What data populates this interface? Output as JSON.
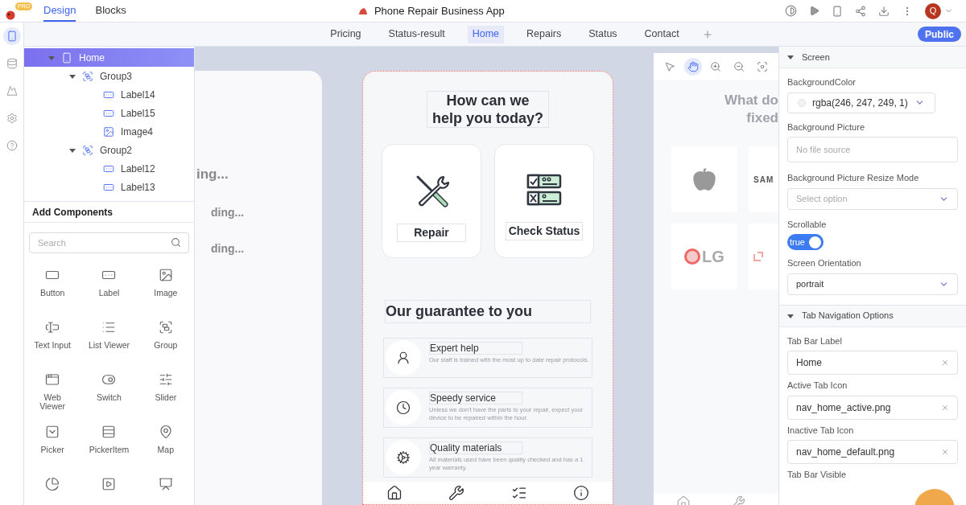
{
  "app": {
    "badge": "PRO",
    "modes": [
      {
        "label": "Design",
        "selected": true
      },
      {
        "label": "Blocks",
        "selected": false
      }
    ],
    "title": "Phone Repair Business App",
    "avatar": "Q"
  },
  "screens": {
    "tabs": [
      {
        "label": "Pricing",
        "selected": false
      },
      {
        "label": "Status-result",
        "selected": false
      },
      {
        "label": "Home",
        "selected": true
      },
      {
        "label": "Repairs",
        "selected": false
      },
      {
        "label": "Status",
        "selected": false
      },
      {
        "label": "Contact",
        "selected": false
      }
    ],
    "publish_button": "Public"
  },
  "rail": [
    {
      "kind": "screens",
      "selected": true
    },
    {
      "kind": "data",
      "selected": false
    },
    {
      "kind": "media",
      "selected": false
    },
    {
      "kind": "settings",
      "selected": false
    },
    {
      "kind": "help",
      "selected": false
    }
  ],
  "tree": [
    {
      "label": "Home",
      "kind": "screen",
      "expanded": true,
      "selected": true,
      "children": [
        {
          "label": "Group3",
          "kind": "group",
          "expanded": true,
          "selected": false,
          "children": [
            {
              "label": "Label14",
              "kind": "label",
              "selected": false
            },
            {
              "label": "Label15",
              "kind": "label",
              "selected": false
            },
            {
              "label": "Image4",
              "kind": "image",
              "selected": false
            }
          ]
        },
        {
          "label": "Group2",
          "kind": "group",
          "expanded": true,
          "selected": false,
          "children": [
            {
              "label": "Label12",
              "kind": "label",
              "selected": false
            },
            {
              "label": "Label13",
              "kind": "label",
              "selected": false
            }
          ]
        }
      ]
    }
  ],
  "components": {
    "title": "Add Components",
    "search": {
      "placeholder": "Search"
    },
    "items": [
      {
        "kind": "button",
        "label": "Button"
      },
      {
        "kind": "label",
        "label": "Label"
      },
      {
        "kind": "image",
        "label": "Image"
      },
      {
        "kind": "textinput",
        "label": "Text Input"
      },
      {
        "kind": "list",
        "label": "List Viewer"
      },
      {
        "kind": "group",
        "label": "Group"
      },
      {
        "kind": "web",
        "label": "Web Viewer"
      },
      {
        "kind": "switch",
        "label": "Switch"
      },
      {
        "kind": "slider",
        "label": "Slider"
      },
      {
        "kind": "picker",
        "label": "Picker"
      },
      {
        "kind": "pickeritem",
        "label": "PickerItem"
      },
      {
        "kind": "map",
        "label": "Map"
      },
      {
        "kind": "chart"
      },
      {
        "kind": "video"
      },
      {
        "kind": "presentation"
      }
    ]
  },
  "left_preview": {
    "texts": [
      "ing...",
      "ding...",
      "ding..."
    ]
  },
  "phone": {
    "heading": [
      "How can we",
      "help you today?"
    ],
    "actions": [
      {
        "kind": "repair",
        "label": "Repair"
      },
      {
        "kind": "status",
        "label": "Check Status"
      }
    ],
    "section_title": "Our guarantee to you",
    "guarantees": [
      {
        "kind": "expert",
        "title": "Expert help",
        "text": "Our staff is trained with the most up to date repair protocols."
      },
      {
        "kind": "speed",
        "title": "Speedy service",
        "text": "Unless we don't have the parts to your repair, expect your device to be repaired within the hour."
      },
      {
        "kind": "quality",
        "title": "Quality materials",
        "text": "All materials used have been quality checked and has a 1 year warranty."
      }
    ],
    "tabs": [
      {
        "kind": "home"
      },
      {
        "kind": "tools"
      },
      {
        "kind": "status"
      },
      {
        "kind": "info"
      }
    ]
  },
  "right_preview": {
    "tools": [
      {
        "kind": "pointer",
        "selected": false
      },
      {
        "kind": "hand",
        "selected": true
      },
      {
        "kind": "zoom-in",
        "selected": false
      },
      {
        "kind": "zoom-out",
        "selected": false
      },
      {
        "kind": "focus",
        "selected": false
      }
    ],
    "heading": [
      "What do",
      "fixed"
    ],
    "brands": [
      {
        "kind": "apple"
      },
      {
        "kind": "wordmark",
        "label": "SAM"
      },
      {
        "kind": "lg",
        "label": "LG"
      },
      {
        "kind": "oneplus"
      }
    ],
    "tabs": [
      {
        "kind": "home"
      },
      {
        "kind": "tools"
      }
    ]
  },
  "properties": {
    "sections": [
      {
        "title": "Screen",
        "expanded": true,
        "fields": [
          {
            "kind": "color",
            "label": "BackgroundColor",
            "value": "rgba(246, 247, 249, 1)"
          },
          {
            "kind": "file",
            "label": "Background Picture",
            "placeholder": "No file source"
          },
          {
            "kind": "select",
            "label": "Background Picture Resize Mode",
            "placeholder": "Select option"
          },
          {
            "kind": "toggle",
            "label": "Scrollable",
            "on": true,
            "value": "true"
          },
          {
            "kind": "select",
            "label": "Screen Orientation",
            "value": "portrait"
          }
        ]
      },
      {
        "title": "Tab Navigation Options",
        "expanded": true,
        "fields": [
          {
            "kind": "clearable",
            "label": "Tab Bar Label",
            "value": "Home"
          },
          {
            "kind": "clearable",
            "label": "Active Tab Icon",
            "value": "nav_home_active.png"
          },
          {
            "kind": "clearable",
            "label": "Inactive Tab Icon",
            "value": "nav_home_default.png"
          },
          {
            "kind": "heading",
            "label": "Tab Bar Visible"
          }
        ]
      }
    ]
  }
}
